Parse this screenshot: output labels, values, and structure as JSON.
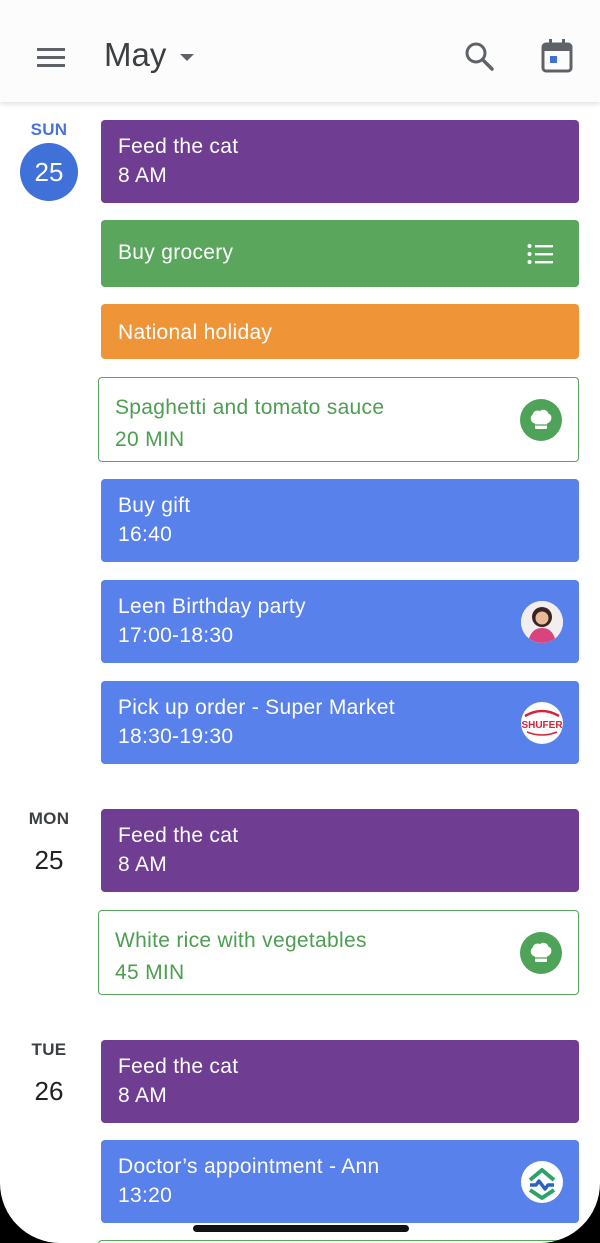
{
  "header": {
    "month": "May",
    "icons": [
      "menu-icon",
      "dropdown-caret-icon",
      "search-icon",
      "calendar-today-icon"
    ],
    "accent_color": "#3f71d8"
  },
  "days": [
    {
      "dow": "SUN",
      "date": "25",
      "is_today": true,
      "events": [
        {
          "title": "Feed the cat",
          "subtitle": "8 AM",
          "color": "#6f3e93"
        },
        {
          "title": "Buy grocery",
          "icon": "list-icon",
          "color": "#59a65c"
        },
        {
          "title": "National holiday",
          "color": "#f09537"
        },
        {
          "title": "Spaghetti and tomato sauce",
          "subtitle": "20 MIN",
          "icon": "chef-hat-icon",
          "color": "#59a65c"
        },
        {
          "title": "Buy gift",
          "subtitle": "16:40",
          "color": "#5881ec"
        },
        {
          "title": "Leen Birthday party",
          "subtitle": "17:00-18:30",
          "icon": "avatar",
          "color": "#5881ec"
        },
        {
          "title": "Pick up order - Super Market",
          "subtitle": "18:30-19:30",
          "icon": "store-logo",
          "logo_text": "SHUFER",
          "color": "#5881ec"
        }
      ]
    },
    {
      "dow": "MON",
      "date": "25",
      "is_today": false,
      "events": [
        {
          "title": "Feed the cat",
          "subtitle": "8 AM",
          "color": "#6f3e93"
        },
        {
          "title": "White rice with vegetables",
          "subtitle": "45 MIN",
          "icon": "chef-hat-icon",
          "color": "#59a65c"
        }
      ]
    },
    {
      "dow": "TUE",
      "date": "26",
      "is_today": false,
      "events": [
        {
          "title": "Feed the cat",
          "subtitle": "8 AM",
          "color": "#6f3e93"
        },
        {
          "title": "Doctor’s appointment - Ann",
          "subtitle": "13:20",
          "icon": "clinic-logo",
          "color": "#5881ec"
        }
      ]
    }
  ]
}
